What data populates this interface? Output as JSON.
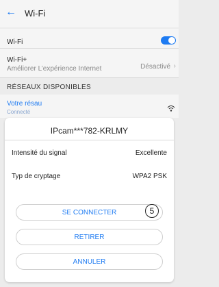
{
  "header": {
    "back_icon": "back-arrow-icon",
    "title": "Wi-Fi"
  },
  "wifi": {
    "label": "Wi-Fi",
    "enabled": true
  },
  "wifi_plus": {
    "label": "Wi-Fi+",
    "subtitle": "Améliorer L’expérience Internet",
    "value": "Désactivé"
  },
  "section": {
    "label": "RÉSEAUX DISPONIBLES"
  },
  "network": {
    "name": "Votre résau",
    "partial_status": "Connecté"
  },
  "dialog": {
    "title": "IPcam***782-KRLMY",
    "signal_label": "Intensité du signal",
    "signal_value": "Excellente",
    "encryption_label": "Typ de cryptage",
    "encryption_value": "WPA2 PSK",
    "connect_label": "SE CONNECTER",
    "connect_step_badge": "5",
    "remove_label": "RETIRER",
    "cancel_label": "ANNULER"
  },
  "colors": {
    "accent": "#1e7bf2",
    "background": "#ececec",
    "surface": "#ffffff",
    "text": "#222222",
    "muted": "#888888"
  }
}
